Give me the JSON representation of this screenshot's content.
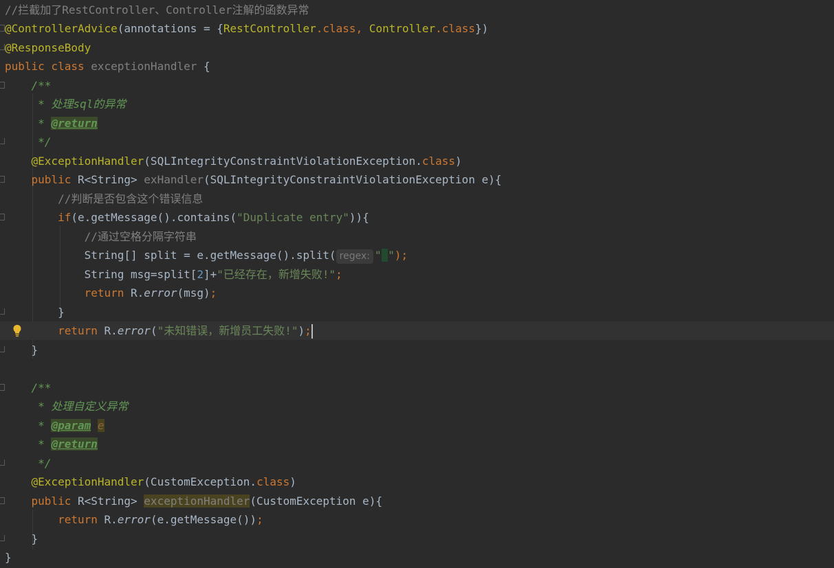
{
  "lines": {
    "l1_comment": "//拦截加了RestController、Controller注解的函数异常",
    "l2_ann": "@ControllerAdvice",
    "l2_open": "(annotations = {",
    "l2_rc": "RestController",
    "l2_dot1": ".",
    "l2_class1": "class",
    "l2_comma": ", ",
    "l2_c": "Controller",
    "l2_dot2": ".",
    "l2_class2": "class",
    "l2_close": "})",
    "l3_ann": "@ResponseBody",
    "l4_kw": "public class ",
    "l4_name": "exceptionHandler",
    "l4_rest": " {",
    "l5_doc": "/**",
    "l6_doc": " * 处理sql的异常",
    "l7_doc": " * ",
    "l7_tag": "@return",
    "l8_doc": " */",
    "l9_ann": "@ExceptionHandler",
    "l9_rest1": "(SQLIntegrityConstraintViolationException.",
    "l9_class": "class",
    "l9_rest2": ")",
    "l10_kw": "public ",
    "l10_type": "R<String> ",
    "l10_name": "exHandler",
    "l10_rest": "(SQLIntegrityConstraintViolationException e){",
    "l11_comment": "//判断是否包含这个错误信息",
    "l12_kw": "if",
    "l12_rest1": "(e.getMessage().contains(",
    "l12_str": "\"Duplicate entry\"",
    "l12_rest2": ")){",
    "l13_comment": "//通过空格分隔字符串",
    "l14_rest1": "String[] split = e.getMessage().split(",
    "l14_hint": "regex:",
    "l14_str_open": "\"",
    "l14_str_space": " ",
    "l14_str_close": "\"",
    "l14_rest2": ");",
    "l15_rest1": "String msg=split[",
    "l15_num": "2",
    "l15_rest2": "]+",
    "l15_str": "\"已经存在，新增失败!\"",
    "l15_semi": ";",
    "l16_kw": "return ",
    "l16_r": "R.",
    "l16_method": "error",
    "l16_rest": "(msg)",
    "l16_semi": ";",
    "l17_brace": "}",
    "l18_kw": "return ",
    "l18_r": "R.",
    "l18_method": "error",
    "l18_open": "(",
    "l18_str": "\"未知错误，新增员工失败!\"",
    "l18_close": ")",
    "l18_semi": ";",
    "l19_brace": "}",
    "l21_doc": "/**",
    "l22_doc": " * 处理自定义异常",
    "l23_doc": " * ",
    "l23_tag": "@param",
    "l23_sp": " ",
    "l23_param": "e",
    "l24_doc": " * ",
    "l24_tag": "@return",
    "l25_doc": " */",
    "l26_ann": "@ExceptionHandler",
    "l26_rest1": "(CustomException.",
    "l26_class": "class",
    "l26_rest2": ")",
    "l27_kw": "public ",
    "l27_type": "R<String> ",
    "l27_name": "exceptionHandler",
    "l27_rest": "(CustomException e){",
    "l28_kw": "return ",
    "l28_r": "R.",
    "l28_method": "error",
    "l28_rest": "(e.getMessage())",
    "l28_semi": ";",
    "l29_brace": "}",
    "l30_brace": "}"
  },
  "colors": {
    "background": "#2b2b2b",
    "current_line": "#323232",
    "keyword": "#cc7832",
    "annotation": "#bbb529",
    "string": "#6a8759",
    "comment": "#808080",
    "doc_comment": "#629755",
    "default_text": "#a9b7c6"
  },
  "icons": {
    "intention": "lightbulb-icon",
    "fold": "fold-marker-icon"
  }
}
